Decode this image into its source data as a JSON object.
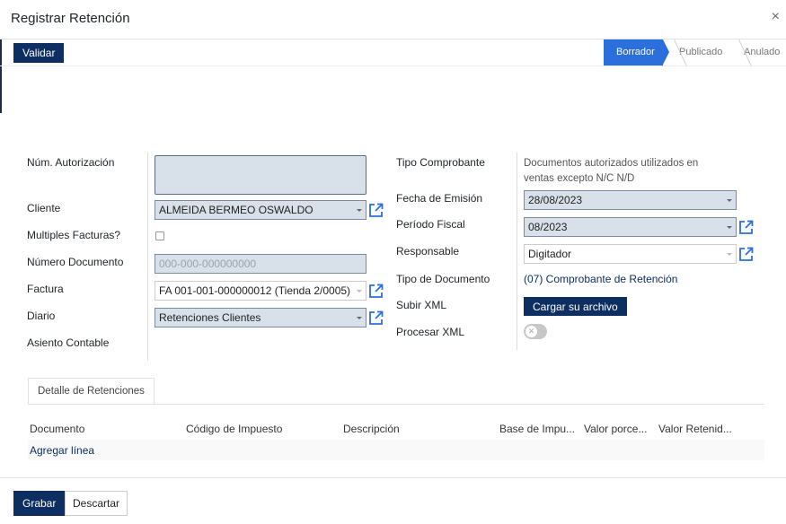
{
  "dialog": {
    "title": "Registrar Retención",
    "close_label": "×"
  },
  "statusbar": {
    "validate_label": "Validar",
    "stages": [
      {
        "label": "Borrador",
        "active": true
      },
      {
        "label": "Publicado",
        "active": false
      },
      {
        "label": "Anulado",
        "active": false
      }
    ]
  },
  "left": {
    "auth_number": {
      "label": "Núm. Autorización",
      "value": ""
    },
    "client": {
      "label": "Cliente",
      "value": "ALMEIDA BERMEO OSWALDO"
    },
    "multiple_invoices": {
      "label": "Multiples Facturas?",
      "checked": false
    },
    "document_number": {
      "label": "Número Documento",
      "placeholder": "000-000-000000000"
    },
    "invoice": {
      "label": "Factura",
      "value": "FA 001-001-000000012 (Tienda 2/0005)"
    },
    "journal": {
      "label": "Diario",
      "value": "Retenciones Clientes"
    },
    "accounting_entry": {
      "label": "Asiento Contable",
      "value": ""
    }
  },
  "right": {
    "voucher_type": {
      "label": "Tipo Comprobante",
      "value": "Documentos autorizados utilizados en ventas excepto N/C N/D"
    },
    "issue_date": {
      "label": "Fecha de Emisión",
      "value": "28/08/2023"
    },
    "fiscal_period": {
      "label": "Período Fiscal",
      "value": "08/2023"
    },
    "responsible": {
      "label": "Responsable",
      "value": "Digitador"
    },
    "document_type": {
      "label": "Tipo de Documento",
      "value": "(07) Comprobante de Retención"
    },
    "upload_xml": {
      "label": "Subir XML",
      "button": "Cargar su archivo"
    },
    "process_xml": {
      "label": "Procesar XML",
      "enabled": false
    }
  },
  "tabs": [
    {
      "label": "Detalle de Retenciones",
      "active": true
    }
  ],
  "table": {
    "columns": [
      "Documento",
      "Código de Impuesto",
      "Descripción",
      "Base de Impu...",
      "Valor porce...",
      "Valor Retenid..."
    ],
    "add_line": "Agregar línea"
  },
  "footer": {
    "save_label": "Grabar",
    "discard_label": "Descartar"
  },
  "colors": {
    "primary": "#0d2e60",
    "active_stage": "#2a6fdb",
    "required_field": "#d8e1ea",
    "link_icon": "#2a6fdb"
  }
}
